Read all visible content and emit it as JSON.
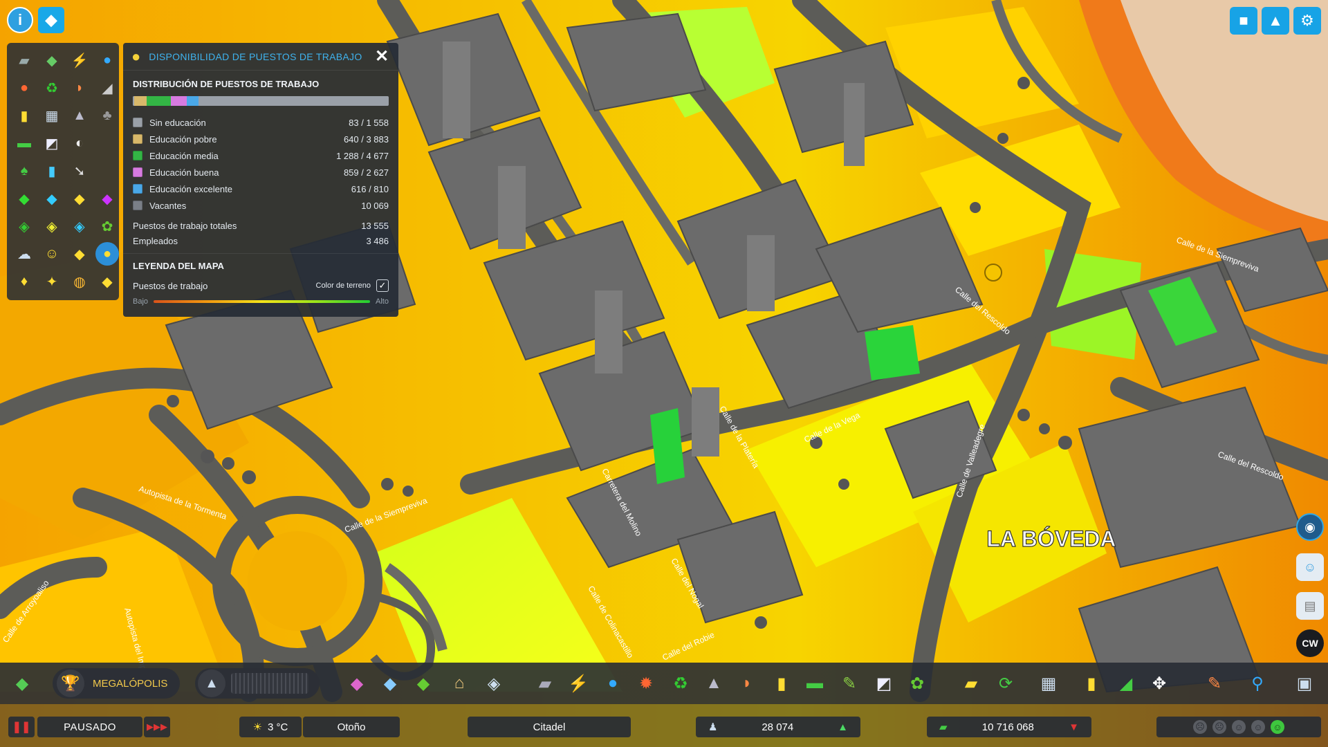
{
  "panel": {
    "title": "DISPONIBILIDAD DE PUESTOS DE TRABAJO",
    "distribution_title": "DISTRIBUCIÓN DE PUESTOS DE TRABAJO",
    "rows": [
      {
        "label": "Sin educación",
        "value": "83 / 1 558",
        "color": "#9aa0a8"
      },
      {
        "label": "Educación pobre",
        "value": "640 / 3 883",
        "color": "#d8b86a"
      },
      {
        "label": "Educación media",
        "value": "1 288 / 4 677",
        "color": "#33b545"
      },
      {
        "label": "Educación buena",
        "value": "859 / 2 627",
        "color": "#d77be0"
      },
      {
        "label": "Educación excelente",
        "value": "616 / 810",
        "color": "#4aa8e8"
      },
      {
        "label": "Vacantes",
        "value": "10 069",
        "color": "#7a7f87"
      }
    ],
    "total_label": "Puestos de trabajo totales",
    "total_value": "13 555",
    "employed_label": "Empleados",
    "employed_value": "3 486",
    "legend_title": "LEYENDA DEL MAPA",
    "legend_label": "Puestos de trabajo",
    "terrain_label": "Color de terreno",
    "terrain_checked": true,
    "low_label": "Bajo",
    "high_label": "Alto"
  },
  "map": {
    "district_label": "LA BÓVEDA",
    "streets": [
      "Autopista de la Tormenta",
      "Calle de la Siempreviva",
      "Carretera del Molino",
      "Calle de Colinacastillo",
      "Calle del Nogal",
      "Calle del Robie",
      "Calle de la Vega",
      "Calle de la Platería",
      "Calle de Valleadegre",
      "Calle del Rescoldo",
      "Autopista del Imperio",
      "Calle de Arroyoaliso",
      "Calle de la Siempreviva",
      "Calle del Rescoldo"
    ]
  },
  "toolbar": {
    "milestone_label": "MEGALÓPOLIS"
  },
  "status": {
    "pause_label": "PAUSADO",
    "temperature": "3 °C",
    "season": "Otoño",
    "city_name": "Citadel",
    "population": "28 074",
    "money": "10 716 068"
  },
  "side_buttons": {
    "cw_label": "CW"
  },
  "colors": {
    "accent": "#3fb3ee",
    "panel_bg": "#262c36",
    "map_low": "#d9531a",
    "map_mid": "#f3e21a",
    "map_high": "#22cc33"
  }
}
